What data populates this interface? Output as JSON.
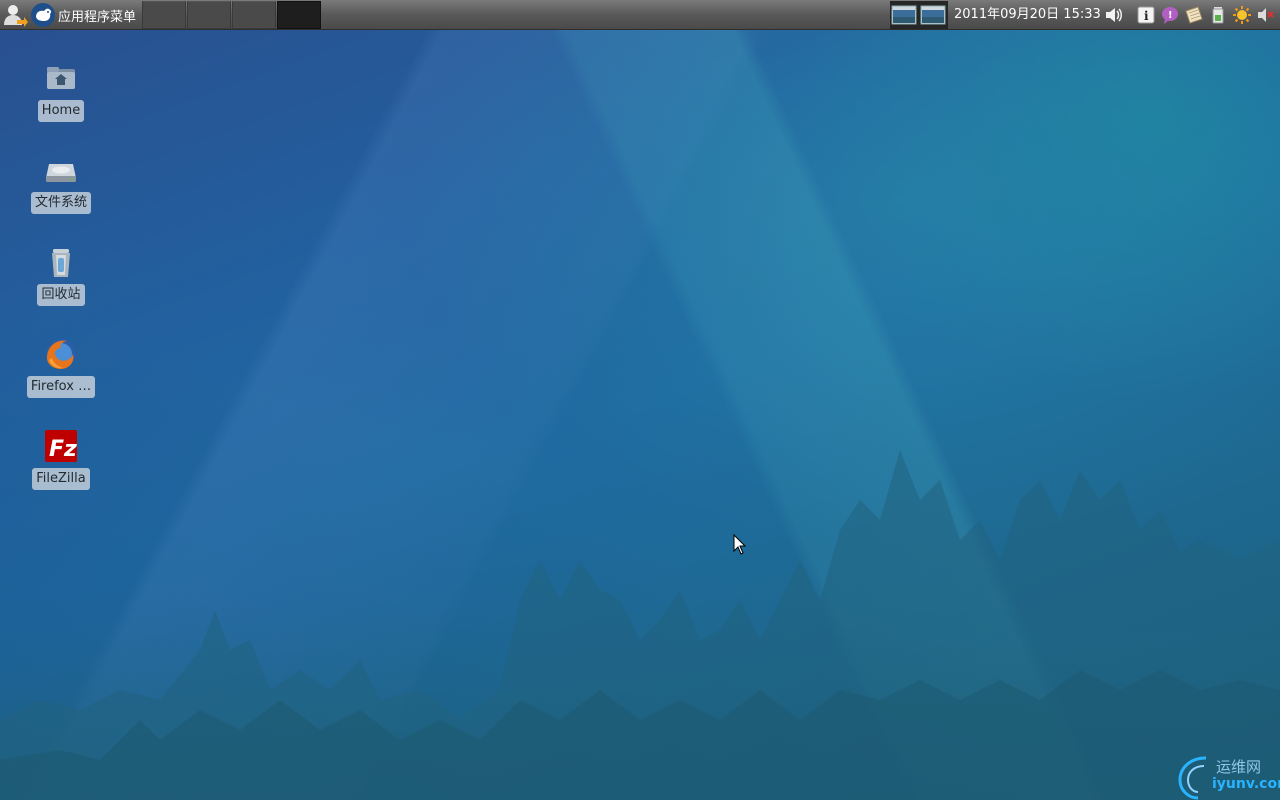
{
  "top_panel": {
    "app_menu_label": "应用程序菜单",
    "workspaces": [
      {
        "active": false
      },
      {
        "active": false
      },
      {
        "active": false
      },
      {
        "active": true
      }
    ],
    "clock": "2011年09月20日 15:33",
    "tray_icons": [
      "volume-icon",
      "info-icon",
      "chat-icon",
      "notes-icon",
      "battery-icon",
      "brightness-icon",
      "mute-icon"
    ]
  },
  "desktop_icons": [
    {
      "name": "home",
      "icon": "home-folder-icon",
      "label": "Home"
    },
    {
      "name": "filesystem",
      "icon": "hard-drive-icon",
      "label": "文件系统"
    },
    {
      "name": "trash",
      "icon": "trash-icon",
      "label": "回收站"
    },
    {
      "name": "firefox",
      "icon": "firefox-icon",
      "label": "Firefox …"
    },
    {
      "name": "filezilla",
      "icon": "filezilla-icon",
      "label": "FileZilla"
    }
  ],
  "watermark": {
    "cn_text": "运维网",
    "domain": "iyunv.com"
  },
  "colors": {
    "panel": "#595959",
    "desktop_blue": "#1f6aa1",
    "label_bg": "#c8d2dc"
  }
}
